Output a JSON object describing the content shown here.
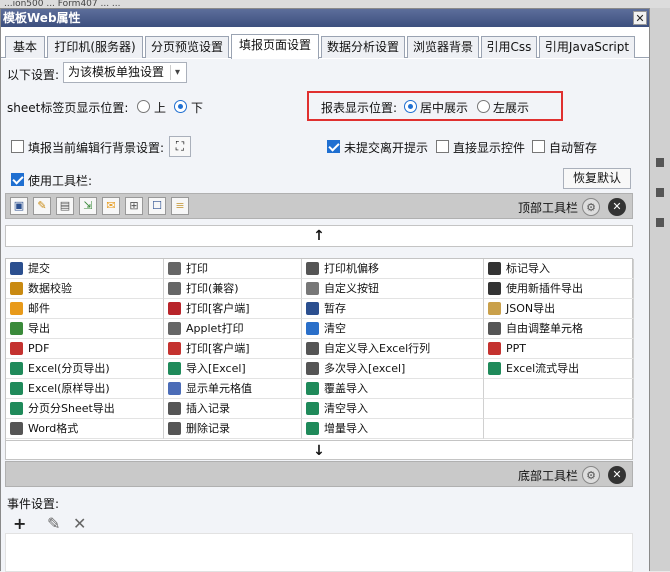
{
  "background": {
    "top_text": "...ion500 ... Form407 ... ...",
    "right_marks": 3
  },
  "dialog": {
    "title": "模板Web属性",
    "close_label": "✕"
  },
  "tabs": [
    {
      "label": "基本",
      "active": false
    },
    {
      "label": "打印机(服务器)",
      "active": false
    },
    {
      "label": "分页预览设置",
      "active": false
    },
    {
      "label": "填报页面设置",
      "active": true
    },
    {
      "label": "数据分析设置",
      "active": false
    },
    {
      "label": "浏览器背景",
      "active": false
    },
    {
      "label": "引用Css",
      "active": false
    },
    {
      "label": "引用JavaScript",
      "active": false
    }
  ],
  "settings": {
    "scope_label": "以下设置:",
    "scope_value": "为该模板单独设置",
    "sheet_label": "sheet标签页显示位置:",
    "sheet_options": [
      "上",
      "下"
    ],
    "sheet_selected": "下",
    "report_pos_label": "报表显示位置:",
    "report_options": [
      "居中展示",
      "左展示"
    ],
    "report_selected": "居中展示",
    "fill_bg_label": "填报当前编辑行背景设置:",
    "fill_bg_checked": false,
    "unsubmitted_label": "未提交离开提示",
    "unsubmitted_checked": true,
    "direct_show_label": "直接显示控件",
    "direct_show_checked": false,
    "autosave_label": "自动暂存",
    "autosave_checked": false,
    "use_toolbar_label": "使用工具栏:",
    "use_toolbar_checked": true,
    "restore_default": "恢复默认"
  },
  "toolbar": {
    "top_title": "顶部工具栏",
    "bottom_title": "底部工具栏",
    "up_arrow": "↑",
    "down_arrow": "↓",
    "top_icons": [
      "save",
      "edit",
      "print",
      "export",
      "mail",
      "insert",
      "cell",
      "json"
    ]
  },
  "button_grid": [
    [
      "提交",
      "打印",
      "打印机偏移",
      "标记导入"
    ],
    [
      "数据校验",
      "打印(兼容)",
      "自定义按钮",
      "使用新插件导出"
    ],
    [
      "邮件",
      "打印[客户端]",
      "暂存",
      "JSON导出"
    ],
    [
      "导出",
      "Applet打印",
      "清空",
      "自由调整单元格"
    ],
    [
      "PDF",
      "打印[客户端]",
      "自定义导入Excel行列",
      "PPT"
    ],
    [
      "Excel(分页导出)",
      "导入[Excel]",
      "多次导入[excel]",
      "Excel流式导出"
    ],
    [
      "Excel(原样导出)",
      "显示单元格值",
      "覆盖导入",
      ""
    ],
    [
      "分页分Sheet导出",
      "插入记录",
      "清空导入",
      ""
    ],
    [
      "Word格式",
      "删除记录",
      "增量导入",
      ""
    ]
  ],
  "grid_icon_colors": [
    [
      "#2b4f8f",
      "#666666",
      "#555555",
      "#333333"
    ],
    [
      "#c98a12",
      "#666666",
      "#777777",
      "#333333"
    ],
    [
      "#e89a1a",
      "#b8242a",
      "#2b4f8f",
      "#c9a04a"
    ],
    [
      "#3a8a3a",
      "#666666",
      "#2a6fc9",
      "#555555"
    ],
    [
      "#c4322f",
      "#c4322f",
      "#555555",
      "#c4322f"
    ],
    [
      "#1f8a5a",
      "#1f8a5a",
      "#555555",
      "#1f8a5a"
    ],
    [
      "#1f8a5a",
      "#4b6cb7",
      "#1f8a5a",
      ""
    ],
    [
      "#1f8a5a",
      "#555555",
      "#1f8a5a",
      ""
    ],
    [
      "#555555",
      "#555555",
      "#1f8a5a",
      ""
    ]
  ],
  "events": {
    "label": "事件设置:",
    "add_icon": "+",
    "edit_icon": "✎",
    "delete_icon": "✕"
  }
}
